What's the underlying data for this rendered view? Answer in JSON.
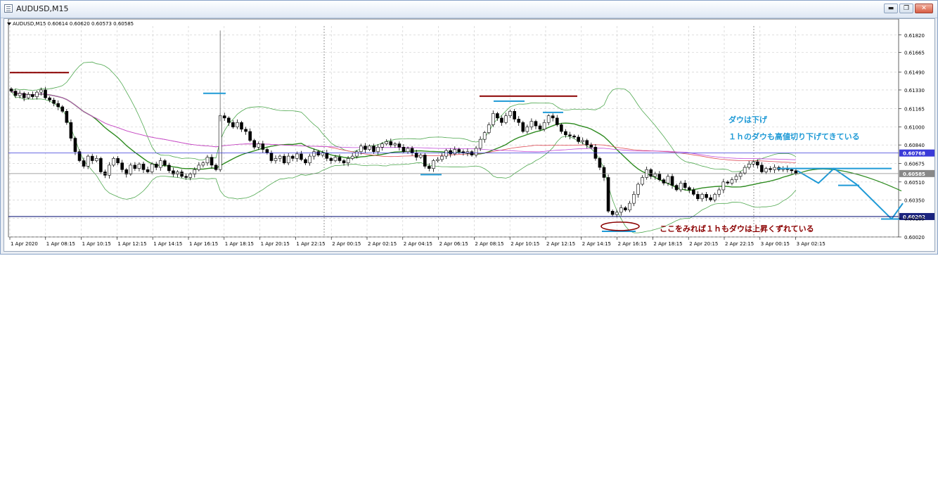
{
  "window": {
    "title": "AUDUSD,M15",
    "buttons": {
      "minimize": "▬",
      "restore": "❐",
      "close": "✕"
    }
  },
  "chart_data": {
    "type": "candlestick",
    "symbol_header": "AUDUSD,M15  0.60614 0.60620 0.60573 0.60585",
    "ylim": [
      0.6002,
      0.619
    ],
    "y_ticks": [
      "0.61820",
      "0.61665",
      "0.61490",
      "0.61330",
      "0.61165",
      "0.61000",
      "0.60840",
      "0.60675",
      "0.60510",
      "0.60350",
      "0.60185",
      "0.60020"
    ],
    "x_ticks": [
      "1 Apr 2020",
      "1 Apr 08:15",
      "1 Apr 10:15",
      "1 Apr 12:15",
      "1 Apr 14:15",
      "1 Apr 16:15",
      "1 Apr 18:15",
      "1 Apr 20:15",
      "1 Apr 22:15",
      "2 Apr 00:15",
      "2 Apr 02:15",
      "2 Apr 04:15",
      "2 Apr 06:15",
      "2 Apr 08:15",
      "2 Apr 10:15",
      "2 Apr 12:15",
      "2 Apr 14:15",
      "2 Apr 16:15",
      "2 Apr 18:15",
      "2 Apr 20:15",
      "2 Apr 22:15",
      "3 Apr 00:15",
      "3 Apr 02:15"
    ],
    "hlines": [
      {
        "value": 0.60768,
        "label": "0.60768",
        "color": "#3a3ad8"
      },
      {
        "value": 0.60585,
        "label": "0.60585",
        "color": "#888888"
      },
      {
        "value": 0.60202,
        "label": "0.60202",
        "color": "#1a237e"
      }
    ],
    "close_series": [
      0.6132,
      0.6128,
      0.613,
      0.6126,
      0.6129,
      0.6127,
      0.6131,
      0.6133,
      0.6126,
      0.6124,
      0.6121,
      0.6118,
      0.6114,
      0.6104,
      0.609,
      0.6078,
      0.607,
      0.6065,
      0.6074,
      0.607,
      0.6072,
      0.606,
      0.6057,
      0.6066,
      0.6072,
      0.6068,
      0.6062,
      0.6058,
      0.6066,
      0.6063,
      0.6067,
      0.6062,
      0.606,
      0.6067,
      0.6064,
      0.607,
      0.6066,
      0.6061,
      0.6058,
      0.606,
      0.6056,
      0.6055,
      0.6058,
      0.6062,
      0.6066,
      0.6068,
      0.6073,
      0.6066,
      0.6062,
      0.611,
      0.6108,
      0.6104,
      0.61,
      0.6104,
      0.6098,
      0.6096,
      0.6088,
      0.6082,
      0.6085,
      0.608,
      0.6077,
      0.607,
      0.6072,
      0.6074,
      0.6068,
      0.6074,
      0.6072,
      0.6076,
      0.6071,
      0.6068,
      0.6074,
      0.6078,
      0.6075,
      0.6077,
      0.6072,
      0.607,
      0.6073,
      0.607,
      0.6068,
      0.6072,
      0.6074,
      0.6078,
      0.6083,
      0.608,
      0.6083,
      0.6078,
      0.6082,
      0.6085,
      0.6087,
      0.6084,
      0.6085,
      0.6082,
      0.6078,
      0.6081,
      0.6077,
      0.6073,
      0.6075,
      0.6065,
      0.6063,
      0.607,
      0.6071,
      0.6074,
      0.6079,
      0.6076,
      0.608,
      0.6078,
      0.6077,
      0.6078,
      0.6075,
      0.6081,
      0.6089,
      0.6095,
      0.6102,
      0.6112,
      0.6108,
      0.6104,
      0.611,
      0.6114,
      0.6107,
      0.6104,
      0.6096,
      0.61,
      0.6105,
      0.6101,
      0.6098,
      0.6104,
      0.611,
      0.6108,
      0.6102,
      0.6096,
      0.6093,
      0.6092,
      0.6091,
      0.6087,
      0.6088,
      0.6084,
      0.6082,
      0.6072,
      0.6064,
      0.6055,
      0.6025,
      0.6022,
      0.6024,
      0.6028,
      0.6026,
      0.6032,
      0.604,
      0.6049,
      0.6055,
      0.6062,
      0.6056,
      0.6058,
      0.6053,
      0.605,
      0.6056,
      0.6048,
      0.6044,
      0.605,
      0.6046,
      0.6044,
      0.604,
      0.6036,
      0.604,
      0.6037,
      0.6035,
      0.604,
      0.6044,
      0.6051,
      0.605,
      0.6053,
      0.6056,
      0.6059,
      0.6064,
      0.6067,
      0.6069,
      0.6066,
      0.606,
      0.6063,
      0.6062,
      0.6064,
      0.6062,
      0.6063,
      0.6062,
      0.6061,
      0.60585
    ],
    "annotations": [
      {
        "text": "ダウは下げ",
        "color": "#1f9ad6"
      },
      {
        "text": "１ｈのダウも高値切り下げてきている",
        "color": "#1f9ad6"
      },
      {
        "text": "ここをみれば１ｈもダウは上昇くずれている",
        "color": "#8b0000"
      }
    ],
    "grid": true,
    "indicators": [
      "Bollinger Bands",
      "Moving averages"
    ]
  }
}
